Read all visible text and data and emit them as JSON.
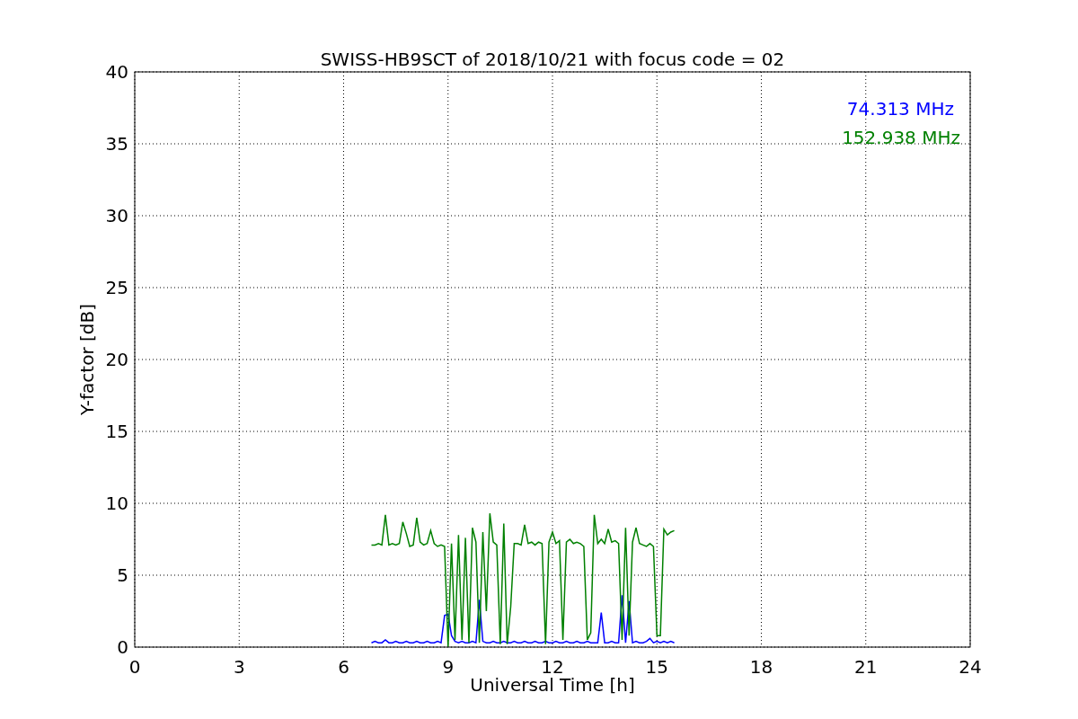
{
  "chart_data": {
    "type": "line",
    "title": "SWISS-HB9SCT of 2018/10/21 with focus code = 02",
    "xlabel": "Universal Time [h]",
    "ylabel": "Y-factor [dB]",
    "x": [
      6.8,
      6.9,
      7.0,
      7.1,
      7.2,
      7.3,
      7.4,
      7.5,
      7.6,
      7.7,
      7.8,
      7.9,
      8.0,
      8.1,
      8.2,
      8.3,
      8.4,
      8.5,
      8.6,
      8.7,
      8.8,
      8.9,
      9.0,
      9.1,
      9.2,
      9.3,
      9.4,
      9.5,
      9.6,
      9.7,
      9.8,
      9.9,
      10.0,
      10.1,
      10.2,
      10.3,
      10.4,
      10.5,
      10.6,
      10.7,
      10.8,
      10.9,
      11.0,
      11.1,
      11.2,
      11.3,
      11.4,
      11.5,
      11.6,
      11.7,
      11.8,
      11.9,
      12.0,
      12.1,
      12.2,
      12.3,
      12.4,
      12.5,
      12.6,
      12.7,
      12.8,
      12.9,
      13.0,
      13.1,
      13.2,
      13.3,
      13.4,
      13.5,
      13.6,
      13.7,
      13.8,
      13.9,
      14.0,
      14.1,
      14.2,
      14.3,
      14.4,
      14.5,
      14.6,
      14.7,
      14.8,
      14.9,
      15.0,
      15.1,
      15.2,
      15.3,
      15.4,
      15.5
    ],
    "series": [
      {
        "name": "74.313 MHz",
        "color": "#0000ff",
        "values": [
          0.3,
          0.4,
          0.3,
          0.3,
          0.5,
          0.3,
          0.3,
          0.4,
          0.3,
          0.3,
          0.4,
          0.3,
          0.3,
          0.4,
          0.3,
          0.3,
          0.4,
          0.3,
          0.3,
          0.4,
          0.3,
          2.2,
          2.3,
          0.8,
          0.4,
          0.3,
          0.4,
          0.3,
          0.3,
          0.4,
          0.3,
          3.3,
          0.4,
          0.3,
          0.3,
          0.4,
          0.3,
          0.3,
          0.4,
          0.3,
          0.3,
          0.4,
          0.3,
          0.3,
          0.4,
          0.3,
          0.3,
          0.4,
          0.3,
          0.3,
          0.4,
          0.3,
          0.3,
          0.4,
          0.3,
          0.3,
          0.4,
          0.3,
          0.3,
          0.4,
          0.3,
          0.3,
          0.4,
          0.3,
          0.3,
          0.3,
          2.4,
          0.3,
          0.3,
          0.4,
          0.3,
          0.3,
          3.6,
          0.3,
          3.2,
          0.3,
          0.4,
          0.3,
          0.3,
          0.4,
          0.6,
          0.3,
          0.4,
          0.3,
          0.4,
          0.3,
          0.4,
          0.3
        ]
      },
      {
        "name": "152.938 MHz",
        "color": "#008000",
        "values": [
          7.1,
          7.1,
          7.2,
          7.1,
          9.2,
          7.1,
          7.2,
          7.1,
          7.2,
          8.7,
          7.9,
          7.0,
          7.1,
          9.0,
          7.3,
          7.1,
          7.2,
          8.1,
          7.2,
          7.0,
          7.1,
          7.0,
          0.0,
          7.2,
          0.5,
          7.8,
          0.5,
          7.6,
          0.3,
          8.3,
          7.3,
          0.3,
          8.0,
          2.5,
          9.3,
          7.3,
          7.1,
          0.2,
          8.6,
          0.2,
          2.8,
          7.2,
          7.2,
          7.1,
          8.5,
          7.2,
          7.3,
          7.1,
          7.3,
          7.2,
          0.2,
          7.3,
          8.0,
          7.2,
          7.4,
          0.5,
          7.3,
          7.5,
          7.2,
          7.3,
          7.2,
          7.0,
          0.5,
          1.0,
          9.2,
          7.2,
          7.5,
          7.2,
          8.2,
          7.3,
          7.4,
          7.2,
          0.5,
          8.3,
          0.8,
          7.3,
          8.3,
          7.2,
          7.1,
          7.0,
          7.2,
          7.0,
          0.8,
          0.8,
          8.2,
          7.8,
          8.0,
          8.1
        ]
      }
    ],
    "grid": true,
    "xlim": [
      0,
      24
    ],
    "ylim": [
      0,
      40
    ],
    "xticks": [
      0,
      3,
      6,
      9,
      12,
      15,
      18,
      21,
      24
    ],
    "yticks": [
      0,
      5,
      10,
      15,
      20,
      25,
      30,
      35,
      40
    ]
  }
}
